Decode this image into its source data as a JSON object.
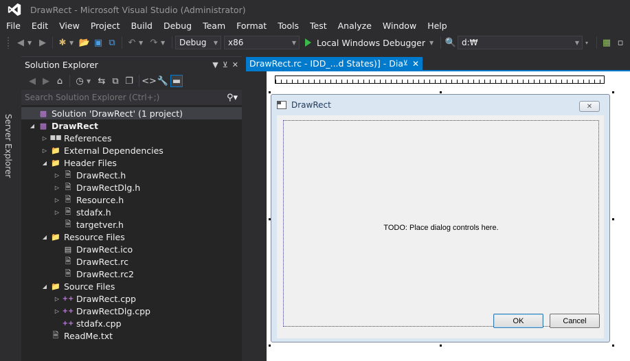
{
  "window": {
    "title": "DrawRect - Microsoft Visual Studio (Administrator)"
  },
  "menu": [
    "File",
    "Edit",
    "View",
    "Project",
    "Build",
    "Debug",
    "Team",
    "Format",
    "Tools",
    "Test",
    "Analyze",
    "Window",
    "Help"
  ],
  "toolbar": {
    "configuration": "Debug",
    "platform": "x86",
    "start_debugger": "Local Windows Debugger",
    "path": "d:₩"
  },
  "server_explorer": {
    "label": "Server Explorer"
  },
  "solution_explorer": {
    "title": "Solution Explorer",
    "search_placeholder": "Search Solution Explorer (Ctrl+;)",
    "tree": [
      {
        "label": "Solution 'DrawRect' (1 project)",
        "level": 0,
        "icon": "solution-icon",
        "expander": "none",
        "selected": true
      },
      {
        "label": "DrawRect",
        "level": 0,
        "icon": "project-icon",
        "expander": "expanded",
        "bold": true
      },
      {
        "label": "References",
        "level": 1,
        "icon": "references-icon",
        "expander": "collapsed"
      },
      {
        "label": "External Dependencies",
        "level": 1,
        "icon": "folder-icon",
        "expander": "collapsed"
      },
      {
        "label": "Header Files",
        "level": 1,
        "icon": "folder-icon",
        "expander": "expanded"
      },
      {
        "label": "DrawRect.h",
        "level": 2,
        "icon": "header-file-icon",
        "expander": "collapsed"
      },
      {
        "label": "DrawRectDlg.h",
        "level": 2,
        "icon": "header-file-icon",
        "expander": "collapsed"
      },
      {
        "label": "Resource.h",
        "level": 2,
        "icon": "header-file-icon",
        "expander": "collapsed"
      },
      {
        "label": "stdafx.h",
        "level": 2,
        "icon": "header-file-icon",
        "expander": "collapsed"
      },
      {
        "label": "targetver.h",
        "level": 2,
        "icon": "header-file-icon",
        "expander": "none"
      },
      {
        "label": "Resource Files",
        "level": 1,
        "icon": "folder-icon",
        "expander": "expanded"
      },
      {
        "label": "DrawRect.ico",
        "level": 2,
        "icon": "image-file-icon",
        "expander": "none"
      },
      {
        "label": "DrawRect.rc",
        "level": 2,
        "icon": "resource-file-icon",
        "expander": "none"
      },
      {
        "label": "DrawRect.rc2",
        "level": 2,
        "icon": "resource-file-icon",
        "expander": "none"
      },
      {
        "label": "Source Files",
        "level": 1,
        "icon": "folder-icon",
        "expander": "expanded"
      },
      {
        "label": "DrawRect.cpp",
        "level": 2,
        "icon": "cpp-file-icon",
        "expander": "collapsed"
      },
      {
        "label": "DrawRectDlg.cpp",
        "level": 2,
        "icon": "cpp-file-icon",
        "expander": "collapsed"
      },
      {
        "label": "stdafx.cpp",
        "level": 2,
        "icon": "cpp-file-icon",
        "expander": "none"
      },
      {
        "label": "ReadMe.txt",
        "level": 1,
        "icon": "text-file-icon",
        "expander": "none"
      }
    ]
  },
  "document_tab": {
    "label": "DrawRect.rc - IDD_...d States)] - Dialog"
  },
  "dialog": {
    "title": "DrawRect",
    "todo_text": "TODO: Place dialog controls here.",
    "ok_label": "OK",
    "cancel_label": "Cancel"
  },
  "colors": {
    "ide_background": "#2d2d30",
    "panel_background": "#252526",
    "accent": "#007acc",
    "canvas": "#ffffff",
    "dialog_frame": "#dbe6f3"
  }
}
